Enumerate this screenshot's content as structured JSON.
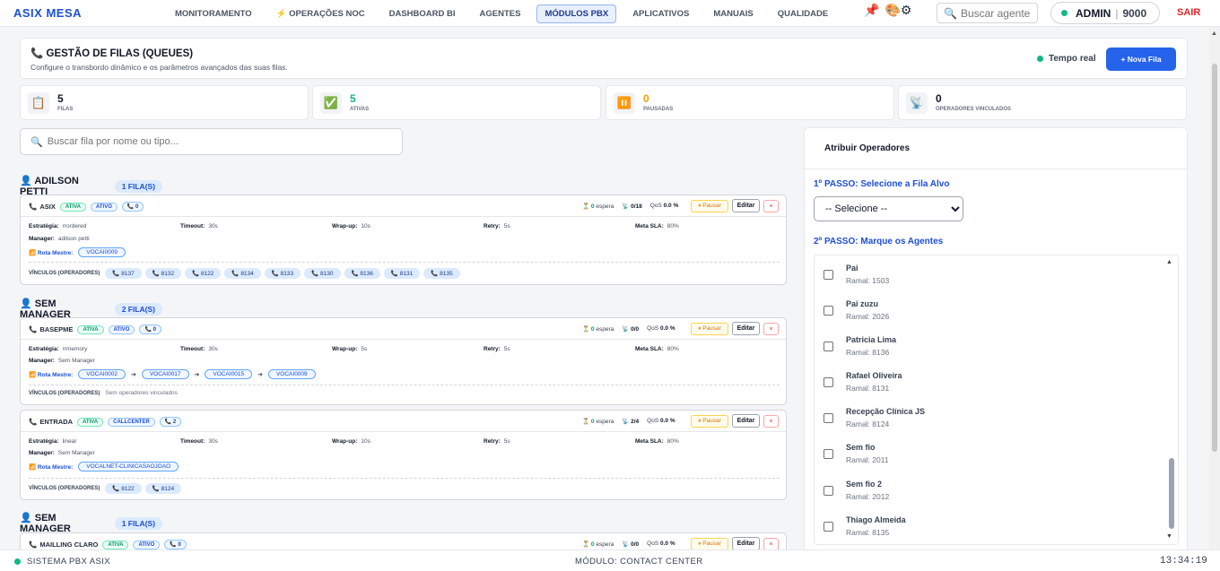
{
  "brand": "ASIX MESA",
  "nav": [
    {
      "label": "MONITORAMENTO"
    },
    {
      "label": "⚡ OPERAÇÕES NOC"
    },
    {
      "label": "DASHBOARD BI"
    },
    {
      "label": "AGENTES"
    },
    {
      "label": "MÓDULOS PBX",
      "active": true
    },
    {
      "label": "APLICATIVOS"
    },
    {
      "label": "MANUAIS"
    },
    {
      "label": "QUALIDADE"
    }
  ],
  "toolbar": {
    "pin_icon": "📌",
    "tools_icons": "🎨⚙",
    "search_icon": "🔍",
    "search_placeholder": "Buscar agente",
    "user_name": "ADMIN",
    "user_sep": "|",
    "user_ext": "9000",
    "logout": "SAIR"
  },
  "header": {
    "title": "📞 GESTÃO DE FILAS (QUEUES)",
    "subtitle": "Configure o transbordo dinâmico e os parâmetros avançados das suas filas.",
    "realtime": "Tempo real",
    "new_button": "+ Nova Fila"
  },
  "stats": [
    {
      "icon": "📋",
      "value": "5",
      "label": "FILAS",
      "color": "#111827"
    },
    {
      "icon": "✅",
      "value": "5",
      "label": "ATIVAS",
      "color": "#10b981"
    },
    {
      "icon": "⏸️",
      "value": "0",
      "label": "PAUSADAS",
      "color": "#f59e0b"
    },
    {
      "icon": "📡",
      "value": "0",
      "label": "OPERADORES VINCULADOS",
      "color": "#111827"
    }
  ],
  "filter": {
    "icon": "🔍",
    "placeholder": "Buscar fila por nome ou tipo..."
  },
  "labels": {
    "strategy": "Estratégia:",
    "timeout": "Timeout:",
    "wrapup": "Wrap-up:",
    "retry": "Retry:",
    "sla": "Meta SLA:",
    "manager": "Manager:",
    "route": "📶 Rota Mestre:",
    "links": "VÍNCULOS (OPERADORES)",
    "wait": "espera",
    "qos": "QoS",
    "pause": "⏸ Pausar",
    "edit": "Editar",
    "delete": "×",
    "no_links": "Sem operadores vinculados"
  },
  "groups": [
    {
      "name": "👤 ADILSON PETTI",
      "count": "1 FILA(S)"
    },
    {
      "name": "👤 SEM MANAGER",
      "count": "2 FILA(S)"
    },
    {
      "name": "👤 SEM MANAGER",
      "count": "1 FILA(S)"
    }
  ],
  "queues": [
    {
      "name": "ASIX",
      "tags": [
        {
          "t": "ATIVA",
          "c": "green"
        },
        {
          "t": "ATIVO",
          "c": "blue"
        },
        {
          "t": "📞 0",
          "c": "gray"
        }
      ],
      "wait": "0",
      "agents": "0/18",
      "qos": "0.0 %",
      "strategy": "rrordered",
      "timeout": "30s",
      "wrapup": "10s",
      "retry": "5s",
      "sla": "80%",
      "manager": "adilson petti",
      "routes": [
        "VOCAI0009"
      ],
      "links": [
        "📞 8137",
        "📞 8132",
        "📞 8122",
        "📞 8134",
        "📞 8133",
        "📞 8130",
        "📞 8136",
        "📞 8131",
        "📞 8135"
      ]
    },
    {
      "name": "BASEPME",
      "tags": [
        {
          "t": "ATIVA",
          "c": "green"
        },
        {
          "t": "ATIVO",
          "c": "blue"
        },
        {
          "t": "📞 0",
          "c": "gray"
        }
      ],
      "wait": "0",
      "agents": "0/0",
      "qos": "0.0 %",
      "strategy": "rrmemory",
      "timeout": "30s",
      "wrapup": "5s",
      "retry": "5s",
      "sla": "80%",
      "manager": "Sem Manager",
      "routes": [
        "VOCAI0002",
        "VOCAI0017",
        "VOCAI0015",
        "VOCAI0009"
      ],
      "links": []
    },
    {
      "name": "ENTRADA",
      "tags": [
        {
          "t": "ATIVA",
          "c": "green"
        },
        {
          "t": "CALLCENTER",
          "c": "blue"
        },
        {
          "t": "📞 2",
          "c": "gray"
        }
      ],
      "wait": "0",
      "agents": "2/4",
      "qos": "0.0 %",
      "strategy": "linear",
      "timeout": "30s",
      "wrapup": "10s",
      "retry": "5s",
      "sla": "80%",
      "manager": "Sem Manager",
      "routes": [
        "VOCALNET-CLINICASAOJOAO"
      ],
      "links": [
        "📞 8122",
        "📞 8124"
      ]
    },
    {
      "name": "MAILLING CLARO",
      "tags": [
        {
          "t": "ATIVA",
          "c": "green"
        },
        {
          "t": "ATIVO",
          "c": "blue"
        },
        {
          "t": "📞 0",
          "c": "gray"
        }
      ],
      "wait": "0",
      "agents": "0/0",
      "qos": "0.0 %"
    }
  ],
  "panel": {
    "title": "Atribuir Operadores",
    "step1": "1º PASSO: Selecione a Fila Alvo",
    "select_value": "-- Selecione --",
    "step2": "2º PASSO: Marque os Agentes",
    "scroll_up": "▲",
    "scroll_down": "▼",
    "agents": [
      {
        "name": "Pai",
        "ramal": "Ramal: 1503"
      },
      {
        "name": "Pai zuzu",
        "ramal": "Ramal: 2026"
      },
      {
        "name": "Patricia Lima",
        "ramal": "Ramal: 8136"
      },
      {
        "name": "Rafael Oliveira",
        "ramal": "Ramal: 8131"
      },
      {
        "name": "Recepção Clínica JS",
        "ramal": "Ramal: 8124"
      },
      {
        "name": "Sem fio",
        "ramal": "Ramal: 2011"
      },
      {
        "name": "Sem fio 2",
        "ramal": "Ramal: 2012"
      },
      {
        "name": "Thiago Almeida",
        "ramal": "Ramal: 8135"
      }
    ]
  },
  "page_scroll_up": "▲",
  "footer": {
    "left": "SISTEMA PBX ASIX",
    "center": "MÓDULO: CONTACT CENTER",
    "time": "13:34:19"
  }
}
